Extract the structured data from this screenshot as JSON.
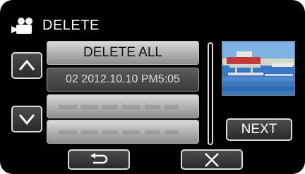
{
  "header": {
    "title": "DELETE",
    "icon": "video-camera-icon"
  },
  "list": {
    "delete_all_label": "DELETE ALL",
    "selected_item": "02 2012.10.10 PM5:05",
    "obscured_rows": 2
  },
  "buttons": {
    "up_icon": "chevron-up-icon",
    "down_icon": "chevron-down-icon",
    "next_label": "NEXT",
    "back_icon": "return-arrow-icon",
    "close_icon": "close-icon"
  },
  "colors": {
    "background": "#000000",
    "button_border": "#dcdcdc",
    "text": "#ffffff"
  }
}
